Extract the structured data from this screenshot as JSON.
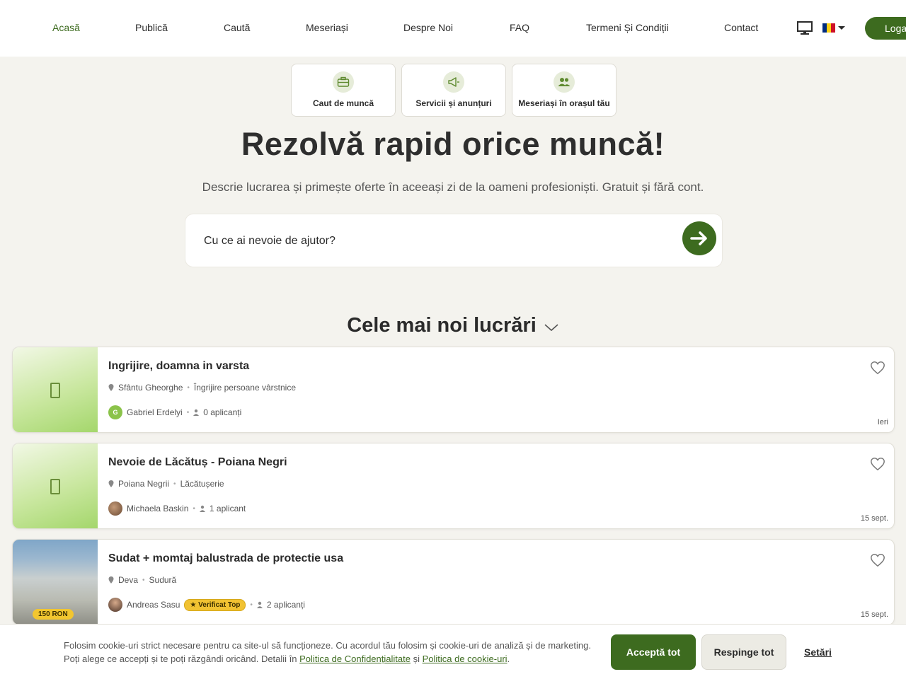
{
  "nav": {
    "items": [
      "Acasă",
      "Publică",
      "Caută",
      "Meseriași",
      "Despre Noi",
      "FAQ",
      "Termeni Și Condiții",
      "Contact"
    ],
    "login_label": "Loga"
  },
  "categories": [
    {
      "label": "Caut de muncă",
      "icon": "briefcase-icon"
    },
    {
      "label": "Servicii și anunțuri",
      "icon": "megaphone-icon"
    },
    {
      "label": "Meseriași în orașul tău",
      "icon": "people-icon"
    }
  ],
  "hero": {
    "title": "Rezolvă rapid orice muncă!",
    "subtitle": "Descrie lucrarea și primește oferte în aceeași zi de la oameni profesioniști. Gratuit și fără cont.",
    "search_placeholder": "Cu ce ai nevoie de ajutor?"
  },
  "section": {
    "title": "Cele mai noi lucrări"
  },
  "jobs": [
    {
      "title": "Ingrijire, doamna in varsta",
      "location": "Sfântu Gheorghe",
      "category": "Îngrijire persoane vârstnice",
      "user": "Gabriel Erdelyi",
      "avatar_letter": "G",
      "applicants": "0 aplicanți",
      "date": "Ieri"
    },
    {
      "title": "Nevoie de Lăcătuș - Poiana Negri",
      "location": "Poiana Negrii",
      "category": "Lăcătușerie",
      "user": "Michaela Baskin",
      "applicants": "1 aplicant",
      "date": "15 sept."
    },
    {
      "title": "Sudat + momtaj balustrada de protectie usa",
      "location": "Deva",
      "category": "Sudură",
      "user": "Andreas Sasu",
      "badge": "★ Verificat Top",
      "applicants": "2 aplicanți",
      "date": "15 sept.",
      "price": "150 RON"
    }
  ],
  "cookie": {
    "text_before": "Folosim cookie-uri strict necesare pentru ca site-ul să funcționeze. Cu acordul tău folosim și cookie-uri de analiză și de marketing. Poți alege ce accepți și te poți răzgândi oricând. Detalii în ",
    "privacy_link": "Politica de Confidențialitate",
    "and": " și ",
    "cookie_link": "Politica de cookie-uri",
    "end": ".",
    "accept_label": "Acceptă tot",
    "reject_label": "Respinge tot",
    "settings_label": "Setări"
  },
  "colors": {
    "accent": "#3d6b1f",
    "background": "#f4f3ee",
    "badge": "#f1c232"
  }
}
